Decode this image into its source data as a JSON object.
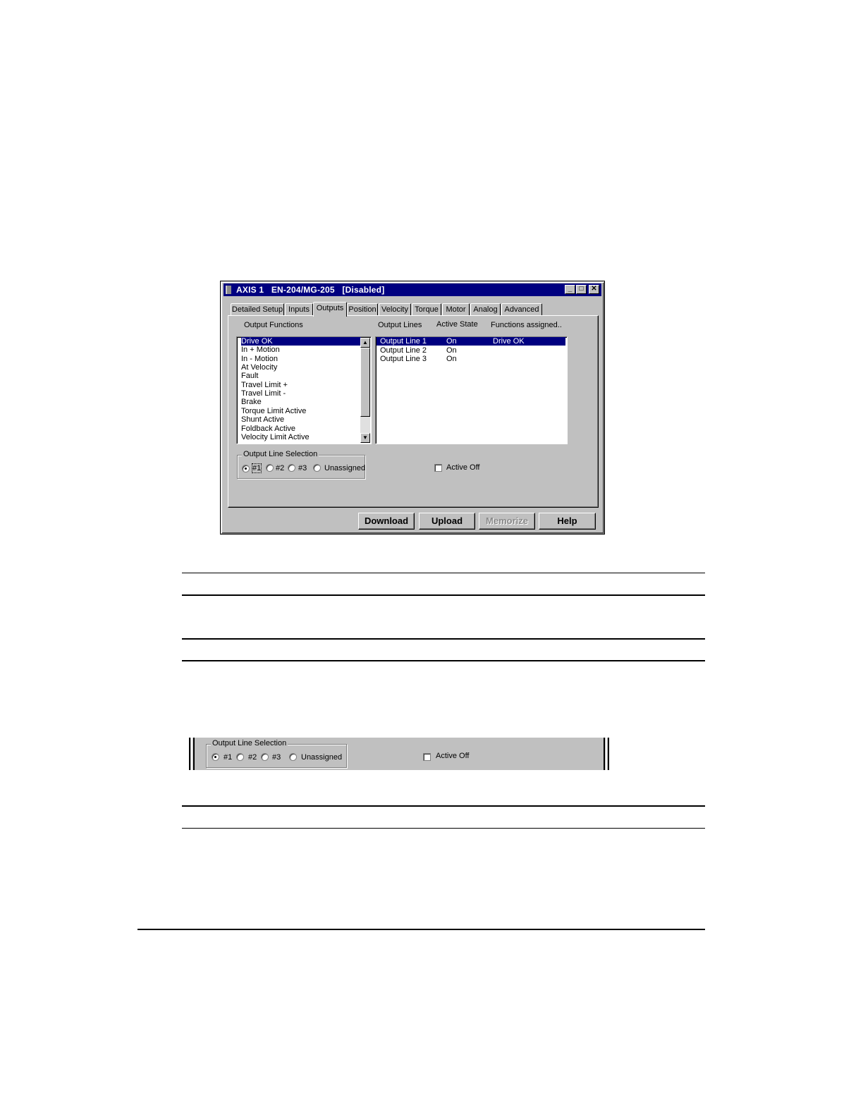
{
  "window": {
    "title": "AXIS 1   EN-204/MG-205   [Disabled]",
    "controls": {
      "minimize": "_",
      "maximize": "□",
      "close": "✕"
    }
  },
  "tabs": [
    {
      "label": "Detailed Setup",
      "active": false
    },
    {
      "label": "Inputs",
      "active": false
    },
    {
      "label": "Outputs",
      "active": true
    },
    {
      "label": "Position",
      "active": false
    },
    {
      "label": "Velocity",
      "active": false
    },
    {
      "label": "Torque",
      "active": false
    },
    {
      "label": "Motor",
      "active": false
    },
    {
      "label": "Analog",
      "active": false
    },
    {
      "label": "Advanced",
      "active": false
    }
  ],
  "output_functions": {
    "label": "Output Functions",
    "items": [
      "Drive OK",
      "In + Motion",
      "In - Motion",
      "At Velocity",
      "Fault",
      "Travel Limit +",
      "Travel Limit -",
      "Brake",
      "Torque Limit Active",
      "Shunt Active",
      "Foldback Active",
      "Velocity Limit Active"
    ],
    "selected_index": 0
  },
  "output_lines": {
    "headers": {
      "line": "Output Lines",
      "state": "Active State",
      "functions": "Functions assigned.."
    },
    "rows": [
      {
        "line": "Output Line 1",
        "state": "On",
        "functions": "Drive OK"
      },
      {
        "line": "Output Line 2",
        "state": "On",
        "functions": ""
      },
      {
        "line": "Output Line 3",
        "state": "On",
        "functions": ""
      }
    ],
    "selected_index": 0
  },
  "line_selection": {
    "title": "Output Line Selection",
    "options": [
      "#1",
      "#2",
      "#3",
      "Unassigned"
    ],
    "selected": "#1"
  },
  "active_off": {
    "label": "Active Off",
    "checked": false
  },
  "buttons": {
    "download": "Download",
    "upload": "Upload",
    "memorize": "Memorize",
    "help": "Help"
  },
  "icons": {
    "title": "drive-app-icon",
    "scroll_up": "arrow-up-icon",
    "scroll_down": "arrow-down-icon"
  },
  "colors": {
    "titlebar": "#000080",
    "face": "#c0c0c0",
    "selection": "#000080"
  }
}
